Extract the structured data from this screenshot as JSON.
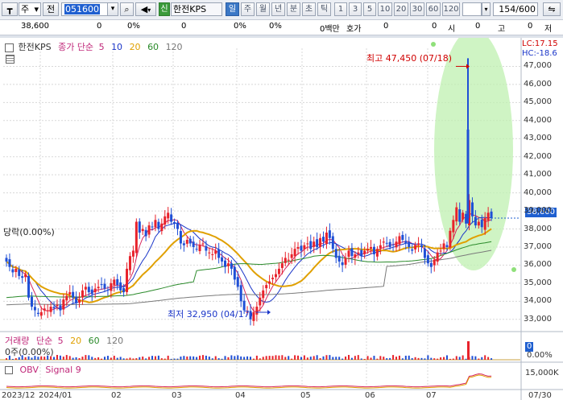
{
  "toolbar": {
    "market": "주",
    "prev_label": "전",
    "code": "051600",
    "new_badge": "신",
    "name": "한전KPS",
    "periods": [
      "일",
      "주",
      "월",
      "년",
      "분",
      "초",
      "틱"
    ],
    "active_period": "일",
    "intervals": [
      "1",
      "3",
      "5",
      "10",
      "20",
      "30",
      "60",
      "120"
    ],
    "count": "154",
    "count_total": "/600"
  },
  "quote": {
    "price": "38,600",
    "change": "0",
    "rate_percent": "0%",
    "v1": "0",
    "v1_pct": "0%",
    "unit": "0백만",
    "hoga_label": "호가",
    "hoga": "0",
    "v2": "0",
    "si_label": "시",
    "si": "0",
    "go_label": "고",
    "go": "0",
    "jeo_label": "저"
  },
  "price_panel": {
    "legend_name": "한전KPS",
    "legend_ma": "종가 단순",
    "ma_periods": [
      "5",
      "10",
      "20",
      "60",
      "120"
    ],
    "ma_colors": [
      "#d6245c",
      "#1a35c8",
      "#e0a000",
      "#2a8a2a",
      "#7a7a7a"
    ],
    "lc_label": "LC:17.15",
    "hc_label": "HC:-18.6",
    "max_label": "최고 47,450 (07/18)",
    "min_label": "최저 32,950 (04/17)",
    "left_label": "당락(0.00%)",
    "current_price": "38,600",
    "y_ticks": [
      "47,000",
      "46,000",
      "45,000",
      "44,000",
      "43,000",
      "42,000",
      "41,000",
      "40,000",
      "39,000",
      "38,000",
      "37,000",
      "36,000",
      "35,000",
      "34,000",
      "33,000"
    ]
  },
  "volume_panel": {
    "legend_name": "거래량",
    "legend_ma": "단순",
    "ma_periods": [
      "5",
      "20",
      "60",
      "120"
    ],
    "left_label": "0주(0.00%)",
    "ticks": [
      "0",
      "0.00%"
    ]
  },
  "obv_panel": {
    "legend_name": "OBV",
    "legend_signal": "Signal 9",
    "tick": "15,000K"
  },
  "x_axis": {
    "labels": [
      "2023/12",
      "2024/01",
      "02",
      "03",
      "04",
      "05",
      "06",
      "07",
      "07/30"
    ]
  },
  "chart_data": {
    "type": "candlestick",
    "ylim": [
      32500,
      48000
    ],
    "high": 47450,
    "low": 32950,
    "last": 38600,
    "close": [
      36200,
      35900,
      35600,
      35800,
      35400,
      35300,
      35500,
      34200,
      33700,
      33500,
      33300,
      33400,
      33600,
      33500,
      33700,
      33600,
      33800,
      33500,
      34100,
      34300,
      34500,
      34200,
      33900,
      34100,
      34600,
      34800,
      34500,
      34400,
      34700,
      34800,
      34900,
      34700,
      34600,
      35000,
      35200,
      34900,
      34600,
      34500,
      35800,
      36500,
      36800,
      38400,
      37800,
      38000,
      37600,
      38200,
      38100,
      38500,
      38000,
      38300,
      38700,
      38900,
      38400,
      38300,
      38000,
      37200,
      37100,
      37400,
      37200,
      37000,
      36900,
      37100,
      37200,
      36800,
      36700,
      36600,
      36800,
      36400,
      36200,
      35900,
      36100,
      35800,
      35200,
      34800,
      34000,
      33500,
      33400,
      33000,
      33400,
      33700,
      34200,
      34600,
      34900,
      35100,
      35300,
      35500,
      35800,
      36100,
      36400,
      36300,
      36600,
      36900,
      37000,
      36800,
      37100,
      37200,
      36900,
      37300,
      37000,
      37500,
      37300,
      37800,
      37500,
      36900,
      36400,
      36200,
      36000,
      36400,
      36800,
      36500,
      36600,
      36700,
      36500,
      36800,
      36900,
      37000,
      36600,
      36900,
      37100,
      37300,
      37200,
      37000,
      37100,
      37300,
      37600,
      37400,
      37200,
      37000,
      36800,
      37100,
      37200,
      37000,
      36400,
      36100,
      35900,
      36300,
      36700,
      36800,
      37200,
      37000,
      37900,
      38500,
      39200,
      38400,
      38900,
      38300,
      39600,
      38700,
      38200,
      38400,
      38100,
      38600,
      38900,
      38600
    ]
  }
}
